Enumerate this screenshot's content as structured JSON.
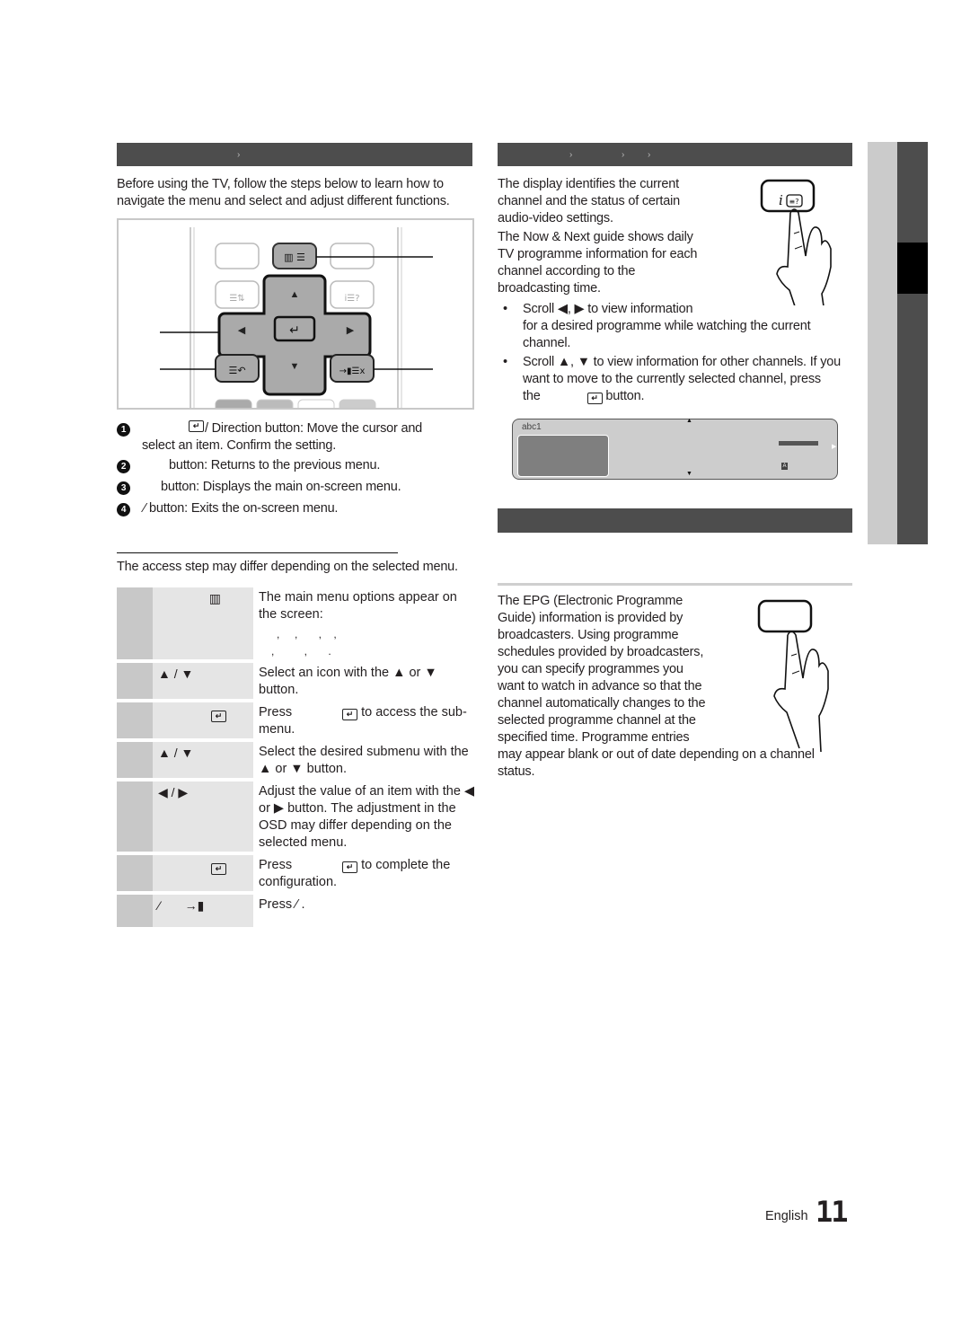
{
  "left": {
    "section_bar_chevron": "›",
    "intro": "Before using the TV, follow the steps below to learn how to navigate the menu and select and adjust different functions.",
    "remote": {
      "menu_button_icons": "▥ ☰i",
      "info_button_icon": "i☰?",
      "tools_button_icon": "☰⇅",
      "return_button_icon": "☰↶",
      "exit_button_icon": "→▮ ☰x",
      "up": "▲",
      "down": "▼",
      "left": "◀",
      "right": "▶",
      "enter": "↵"
    },
    "legend": [
      {
        "num": "1",
        "icon": "↵",
        "text": " / Direction button: Move the cursor and",
        "text2": "select an item. Confirm the setting."
      },
      {
        "num": "2",
        "text": "button: Returns to the previous menu."
      },
      {
        "num": "3",
        "text": "button: Displays the main on-screen menu."
      },
      {
        "num": "4",
        "text": "⁄   button: Exits the on-screen menu."
      }
    ],
    "access_note": "The access step may differ depending on the selected menu.",
    "steps": [
      {
        "key": "▥",
        "desc": "The main menu options appear on the screen:",
        "extra1": ",     ,       ,    ,",
        "extra2": ",          ,       ."
      },
      {
        "key": "▲ / ▼",
        "desc": "Select an icon with the ▲ or ▼ button."
      },
      {
        "key": "↵",
        "desc_pre": "Press",
        "desc_post": "to access the sub-menu."
      },
      {
        "key": "▲ / ▼",
        "desc": "Select the desired submenu with the ▲ or ▼ button."
      },
      {
        "key": "◀ / ▶",
        "desc": "Adjust the value of an item with the ◀ or ▶ button. The adjustment in the OSD may differ depending on the selected menu."
      },
      {
        "key": "↵",
        "desc_pre": "Press",
        "desc_post": "to complete the configuration."
      },
      {
        "key": "⁄       →▮",
        "desc": "Press ⁄ ."
      }
    ]
  },
  "right": {
    "section_bar_chevrons": [
      "›",
      "›",
      "›"
    ],
    "info_p1": "The display identifies the current channel and the status of certain audio-video settings.",
    "info_p2": "The Now & Next guide shows daily TV programme information for each channel according to the broadcasting time.",
    "info_button_label": "i☰?",
    "bullets": [
      {
        "text": "Scroll ◀, ▶ to view information",
        "text2": "for a desired programme while watching the current channel."
      },
      {
        "text": "Scroll ▲, ▼ to view information for other channels. If you want to move to the currently selected channel, press",
        "text_last_pre": "the",
        "text_last_post": "button."
      }
    ],
    "osd": {
      "channel": "abc1",
      "badge": "A"
    },
    "epg_text_wrapped": [
      "The EPG (Electronic Programme",
      "Guide) information is provided by",
      "broadcasters. Using programme",
      "schedules provided by broadcasters,",
      "you can specify programmes you",
      "want to watch in advance so that the",
      "channel automatically changes to the",
      "selected programme channel at the",
      "specified time. Programme entries"
    ],
    "epg_text_full": "may appear blank or out of date depending on a channel status."
  },
  "footer": {
    "language": "English",
    "page_number": "11"
  }
}
